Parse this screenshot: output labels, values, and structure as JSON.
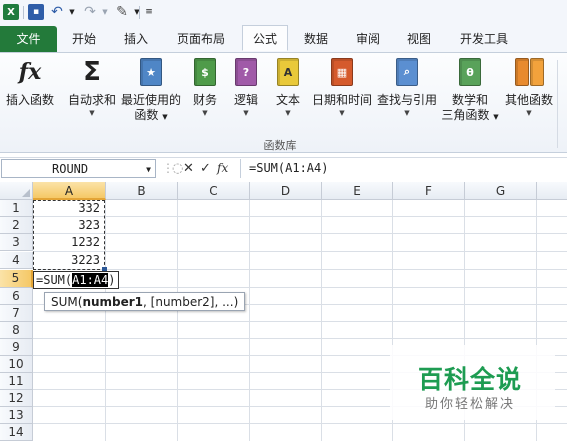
{
  "qat": {
    "icons": [
      "excel-logo",
      "save-icon",
      "undo-icon",
      "redo-icon",
      "customize-tool-icon"
    ]
  },
  "tabs": [
    {
      "label": "文件"
    },
    {
      "label": "开始"
    },
    {
      "label": "插入"
    },
    {
      "label": "页面布局"
    },
    {
      "label": "公式"
    },
    {
      "label": "数据"
    },
    {
      "label": "审阅"
    },
    {
      "label": "视图"
    },
    {
      "label": "开发工具"
    }
  ],
  "active_tab": "公式",
  "ribbon": {
    "group_label": "函数库",
    "buttons": [
      {
        "label": "插入函数",
        "icon": "fx-icon"
      },
      {
        "label": "自动求和",
        "icon": "sigma-icon",
        "dropdown": true
      },
      {
        "label": "最近使用的",
        "label2": "函数",
        "icon": "star-book-icon",
        "dropdown": true
      },
      {
        "label": "财务",
        "icon": "finance-book-icon",
        "dropdown": true
      },
      {
        "label": "逻辑",
        "icon": "logic-book-icon",
        "dropdown": true
      },
      {
        "label": "文本",
        "icon": "text-book-icon",
        "dropdown": true
      },
      {
        "label": "日期和时间",
        "icon": "date-book-icon",
        "dropdown": true
      },
      {
        "label": "查找与引用",
        "icon": "lookup-book-icon",
        "dropdown": true
      },
      {
        "label": "数学和",
        "label2": "三角函数",
        "icon": "math-book-icon",
        "dropdown": true
      },
      {
        "label": "其他函数",
        "icon": "more-books-icon",
        "dropdown": true
      }
    ]
  },
  "formula_bar": {
    "name_box": "ROUND",
    "cancel": "✕",
    "enter": "✓",
    "fx": "fx",
    "formula": "=SUM(A1:A4)"
  },
  "columns": [
    "A",
    "B",
    "C",
    "D",
    "E",
    "F",
    "G"
  ],
  "rows": [
    "1",
    "2",
    "3",
    "4",
    "5",
    "6",
    "7",
    "8",
    "9",
    "10",
    "11",
    "12",
    "13",
    "14"
  ],
  "cells": {
    "A1": "332",
    "A2": "323",
    "A3": "1232",
    "A4": "3223"
  },
  "edit_cell": {
    "prefix": "=SUM(",
    "range": "A1:A4",
    "suffix": ")"
  },
  "tooltip": {
    "func": "SUM(",
    "arg1": "number1",
    "rest": ", [number2], ...)"
  },
  "watermark": {
    "title": "百科全说",
    "subtitle": "助你轻松解决"
  },
  "colors": {
    "file_tab": "#237a3a",
    "selected_header": "#f5c866",
    "watermark": "#1e9c52"
  }
}
